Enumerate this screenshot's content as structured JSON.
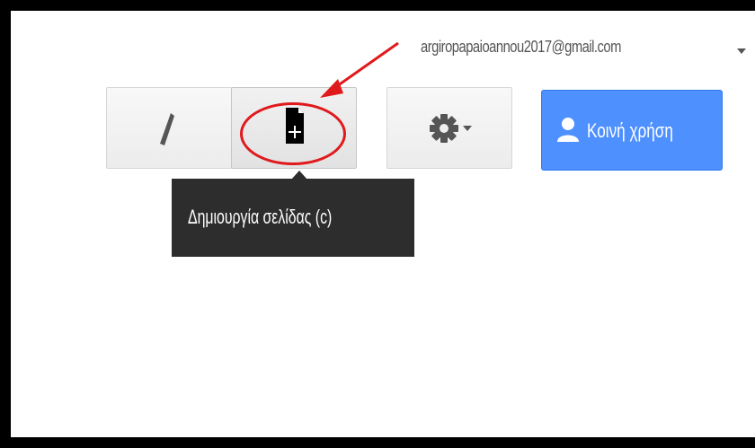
{
  "account": {
    "email": "argiropapaioannou2017@gmail.com"
  },
  "toolbar": {
    "edit_icon": "pencil-icon",
    "new_page_icon": "new-page-icon",
    "settings_icon": "gear-icon",
    "share_icon": "person-icon",
    "share_label": "Κοινή χρήση"
  },
  "tooltip": {
    "text": "Δημιουργία σελίδας (c)"
  },
  "annotation": {
    "color": "#e0191c"
  },
  "colors": {
    "share_button": "#4d90fe",
    "tooltip_bg": "#2d2d2d"
  }
}
